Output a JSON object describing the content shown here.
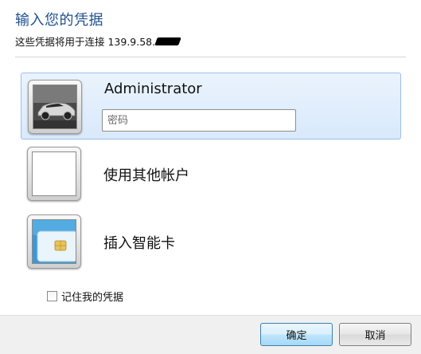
{
  "dialog": {
    "title": "输入您的凭据",
    "subtitle": "这些凭据将用于连接 139.9.58."
  },
  "tiles": [
    {
      "label": "Administrator",
      "password_placeholder": "密码",
      "icon": "car-icon",
      "selected": true
    },
    {
      "label": "使用其他帐户",
      "icon": "blank-user-icon",
      "selected": false
    },
    {
      "label": "插入智能卡",
      "icon": "smart-card-icon",
      "selected": false
    }
  ],
  "remember": {
    "label": "记住我的凭据",
    "checked": false
  },
  "buttons": {
    "ok_label": "确定",
    "cancel_label": "取消"
  },
  "colors": {
    "title": "#1f4f8f",
    "selected_tile_bg": "#d9e9fb",
    "selected_tile_border": "#9cc0e8",
    "footer_bg": "#f0f0f0"
  }
}
